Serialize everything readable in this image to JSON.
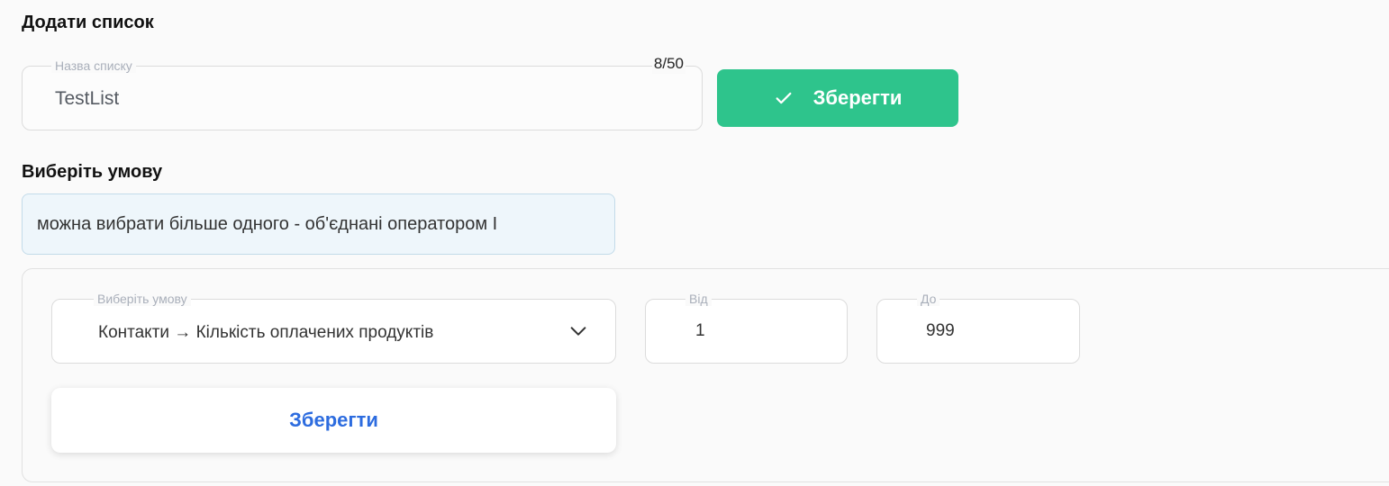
{
  "add_list": {
    "title": "Додати список",
    "name_field": {
      "legend": "Назва списку",
      "value": "TestList",
      "counter": "8/50"
    },
    "save_label": "Зберегти"
  },
  "condition": {
    "title": "Виберіть умову",
    "hint": "можна вибрати більше одного - об'єднані оператором І",
    "select": {
      "legend": "Виберіть умову",
      "value": "Контакти → Кількість оплачених продуктів"
    },
    "from": {
      "legend": "Від",
      "value": "1"
    },
    "to": {
      "legend": "До",
      "value": "999"
    },
    "save_label": "Зберегти"
  },
  "colors": {
    "primary_green": "#2ec48c",
    "link_blue": "#2d6cdf",
    "hint_bg": "#eef6fb"
  }
}
